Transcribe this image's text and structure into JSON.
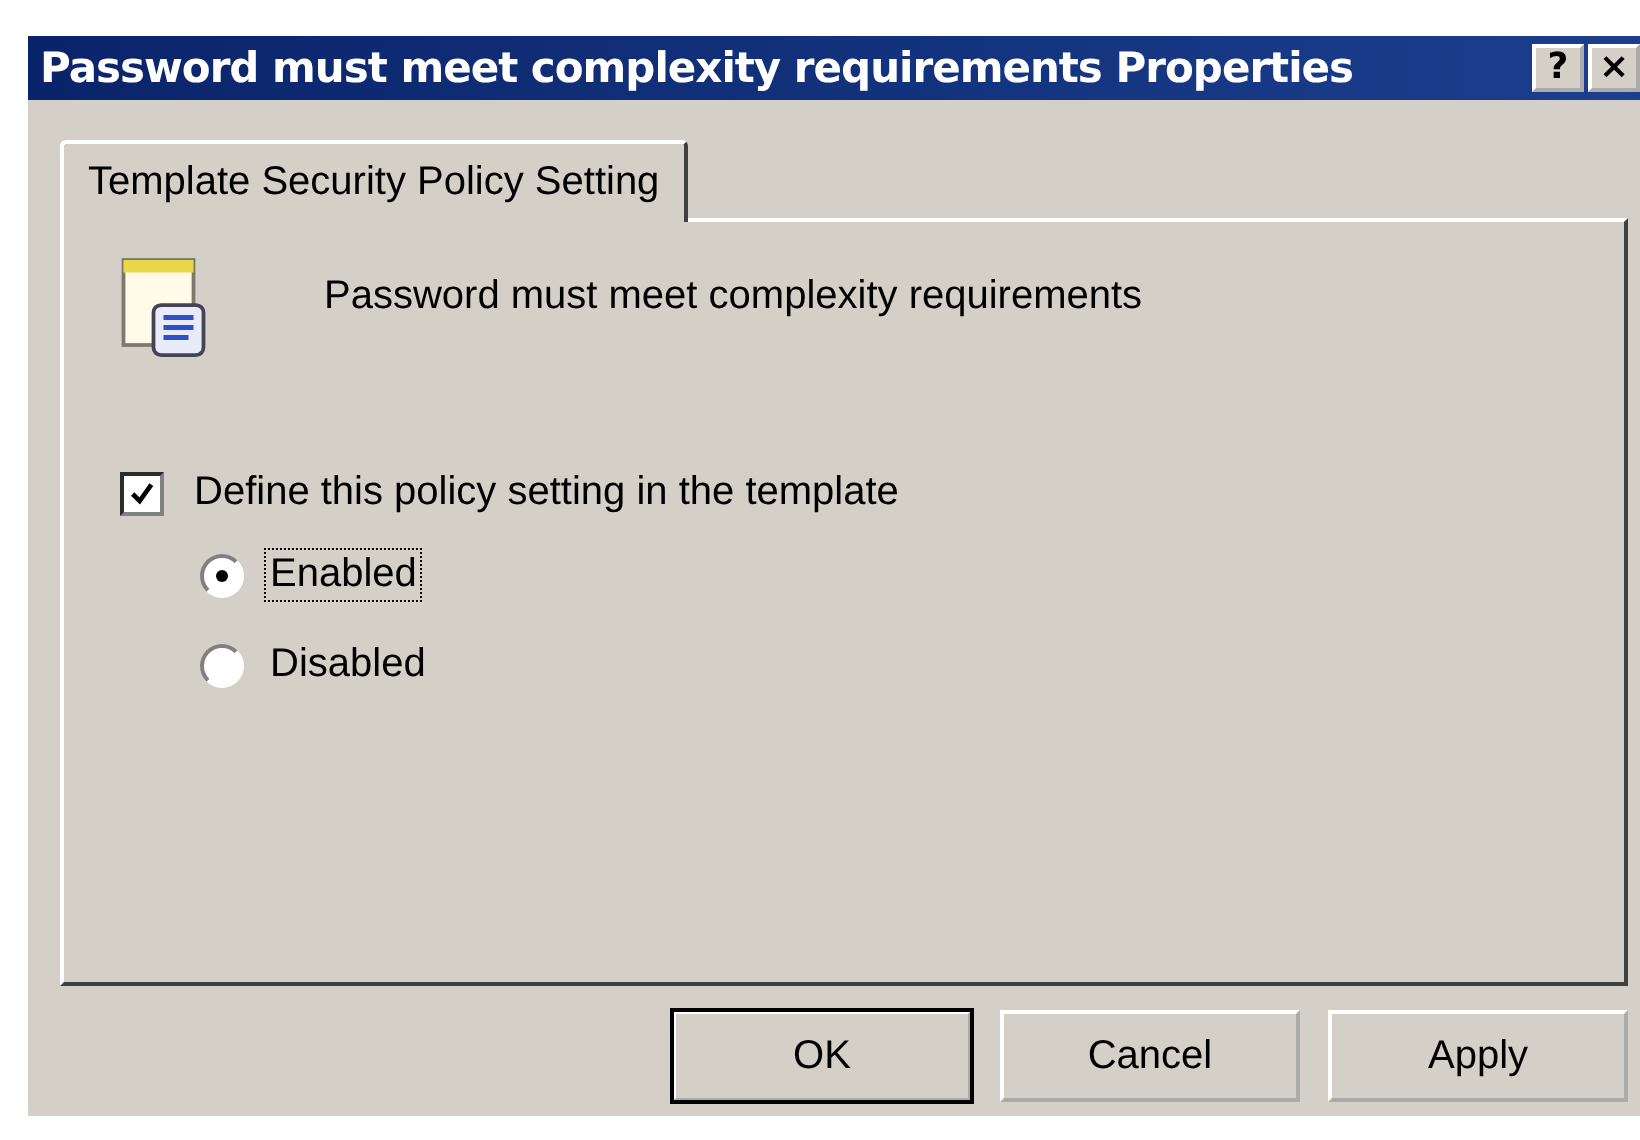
{
  "window": {
    "title": "Password must meet complexity requirements Properties",
    "title_buttons": [
      "?",
      "×"
    ]
  },
  "tabs": [
    {
      "label": "Template Security Policy Setting",
      "selected": true
    }
  ],
  "policy": {
    "name": "Password must meet complexity requirements"
  },
  "define_checkbox": {
    "label": "Define this policy setting in the template",
    "checked": true
  },
  "options": [
    {
      "label": "Enabled",
      "selected": true,
      "focused": true
    },
    {
      "label": "Disabled",
      "selected": false,
      "focused": false
    }
  ],
  "buttons": [
    {
      "label": "OK",
      "default": true
    },
    {
      "label": "Cancel",
      "default": false
    },
    {
      "label": "Apply",
      "default": false
    }
  ]
}
